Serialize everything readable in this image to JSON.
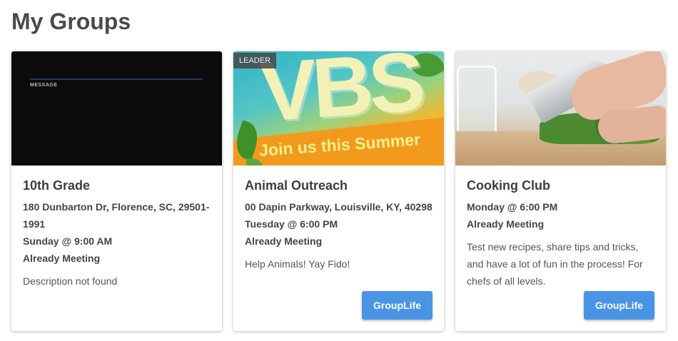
{
  "page": {
    "title": "My Groups"
  },
  "groups": [
    {
      "name": "10th Grade",
      "image_overlay_text": "MESSAGE",
      "address": "180 Dunbarton Dr, Florence, SC, 29501-1991",
      "schedule": "Sunday @ 9:00 AM",
      "status": "Already Meeting",
      "description": "Description not found"
    },
    {
      "name": "Animal Outreach",
      "badge": "LEADER",
      "banner_big_text": "VBS",
      "banner_tagline": "Join us this Summer",
      "address": "00 Dapin Parkway, Louisville, KY, 40298",
      "schedule": "Tuesday @ 6:00 PM",
      "status": "Already Meeting",
      "description": "Help Animals! Yay Fido!",
      "button_label": "GroupLife"
    },
    {
      "name": "Cooking Club",
      "schedule": "Monday @ 6:00 PM",
      "status": "Already Meeting",
      "description": "Test new recipes, share tips and tricks, and have a lot of fun in the process! For chefs of all levels.",
      "button_label": "GroupLife"
    }
  ],
  "colors": {
    "button": "#4a94e6",
    "title": "#4a4a4a",
    "leader_badge": "#464646"
  }
}
